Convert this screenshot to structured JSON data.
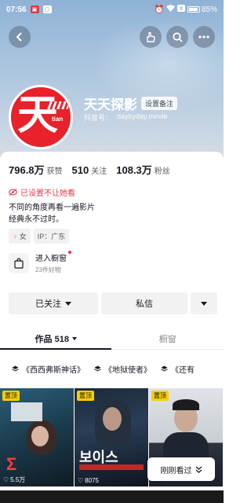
{
  "status_bar": {
    "time": "07:56",
    "battery": "85%"
  },
  "colors": {
    "accent_red": "#e83a4f",
    "pin_yellow": "#facd00",
    "avatar_red": "#e8212b"
  },
  "profile": {
    "name": "天天探影",
    "note_tag": "设置备注",
    "id_label": "抖音号：",
    "id_value": "daybyday.movie",
    "avatar_text": "天",
    "avatar_subtext": "tian"
  },
  "stats": [
    {
      "value": "796.8万",
      "label": "获赞"
    },
    {
      "value": "510",
      "label": "关注"
    },
    {
      "value": "108.3万",
      "label": "粉丝"
    }
  ],
  "blocked_text": "已设置不让她看",
  "bio": [
    "不同的角度再看一遍影片",
    "经典永不过时。"
  ],
  "tags": [
    {
      "icon": "female-icon",
      "text": "女"
    },
    {
      "icon": "",
      "text": "IP：广东"
    }
  ],
  "shop": {
    "title": "进入橱窗",
    "subtitle": "23件好物"
  },
  "buttons": {
    "following": "已关注",
    "message": "私信"
  },
  "tabs": [
    {
      "label": "作品 518",
      "active": true
    },
    {
      "label": "橱窗",
      "active": false
    }
  ],
  "collections": [
    "《西西弗斯神话》",
    "《地狱使者》",
    "《还有"
  ],
  "videos": [
    {
      "pinned": "置顶",
      "likes": "5.5万",
      "poster_text": "Σ"
    },
    {
      "pinned": "置顶",
      "likes": "8075",
      "poster_text": "보이스"
    },
    {
      "pinned": "置顶",
      "likes": "",
      "poster_text": ""
    }
  ],
  "just_watched": "刚刚看过"
}
